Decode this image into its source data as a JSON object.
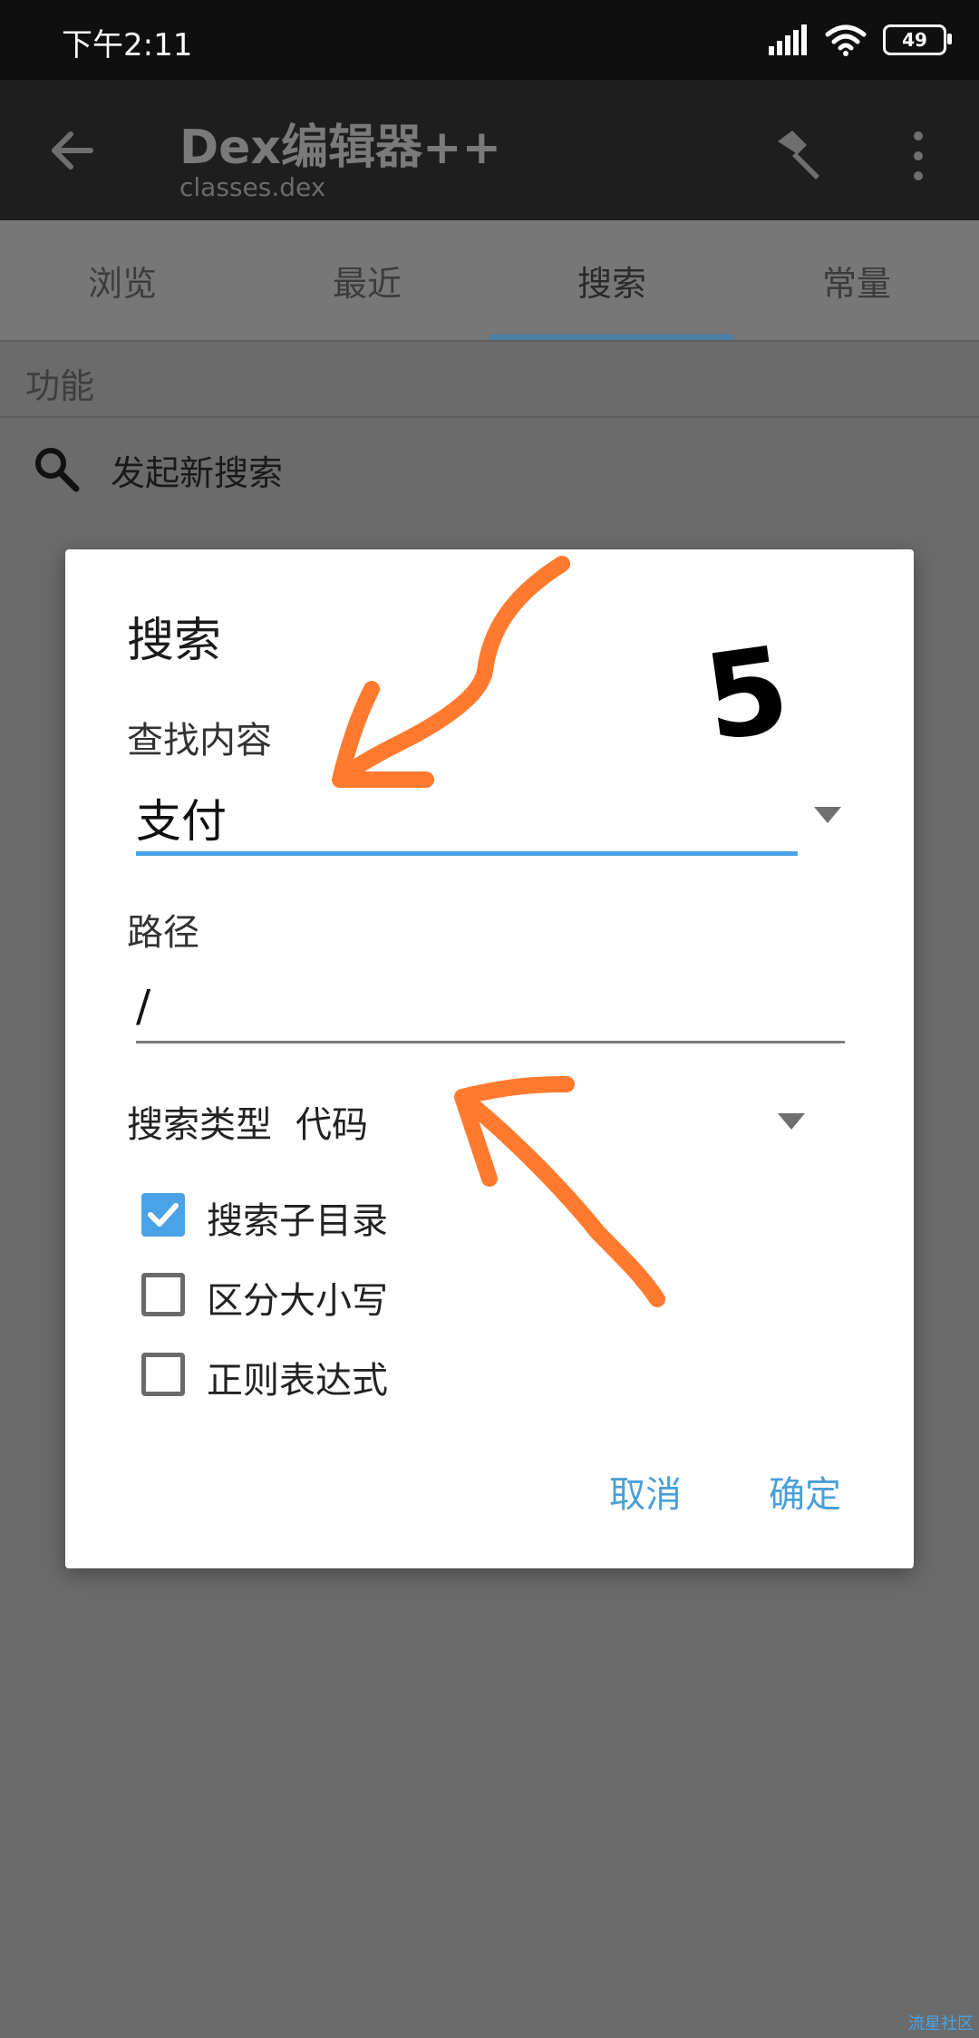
{
  "status": {
    "time": "下午2:11",
    "battery": "49"
  },
  "app": {
    "title": "Dex编辑器++",
    "subtitle": "classes.dex"
  },
  "tabs": [
    {
      "label": "浏览"
    },
    {
      "label": "最近"
    },
    {
      "label": "搜索"
    },
    {
      "label": "常量"
    }
  ],
  "section": {
    "header": "功能",
    "item": "发起新搜索"
  },
  "dialog": {
    "title": "搜索",
    "find_label": "查找内容",
    "find_value": "支付",
    "path_label": "路径",
    "path_value": "/",
    "type_label": "搜索类型",
    "type_value": "代码",
    "options": [
      {
        "label": "搜索子目录",
        "checked": true
      },
      {
        "label": "区分大小写",
        "checked": false
      },
      {
        "label": "正则表达式",
        "checked": false
      }
    ],
    "cancel": "取消",
    "ok": "确定"
  },
  "annotation": {
    "number": "5"
  },
  "watermark": "流星社区",
  "colors": {
    "accent": "#4aa3e6",
    "annotation": "#ff7a2e"
  }
}
